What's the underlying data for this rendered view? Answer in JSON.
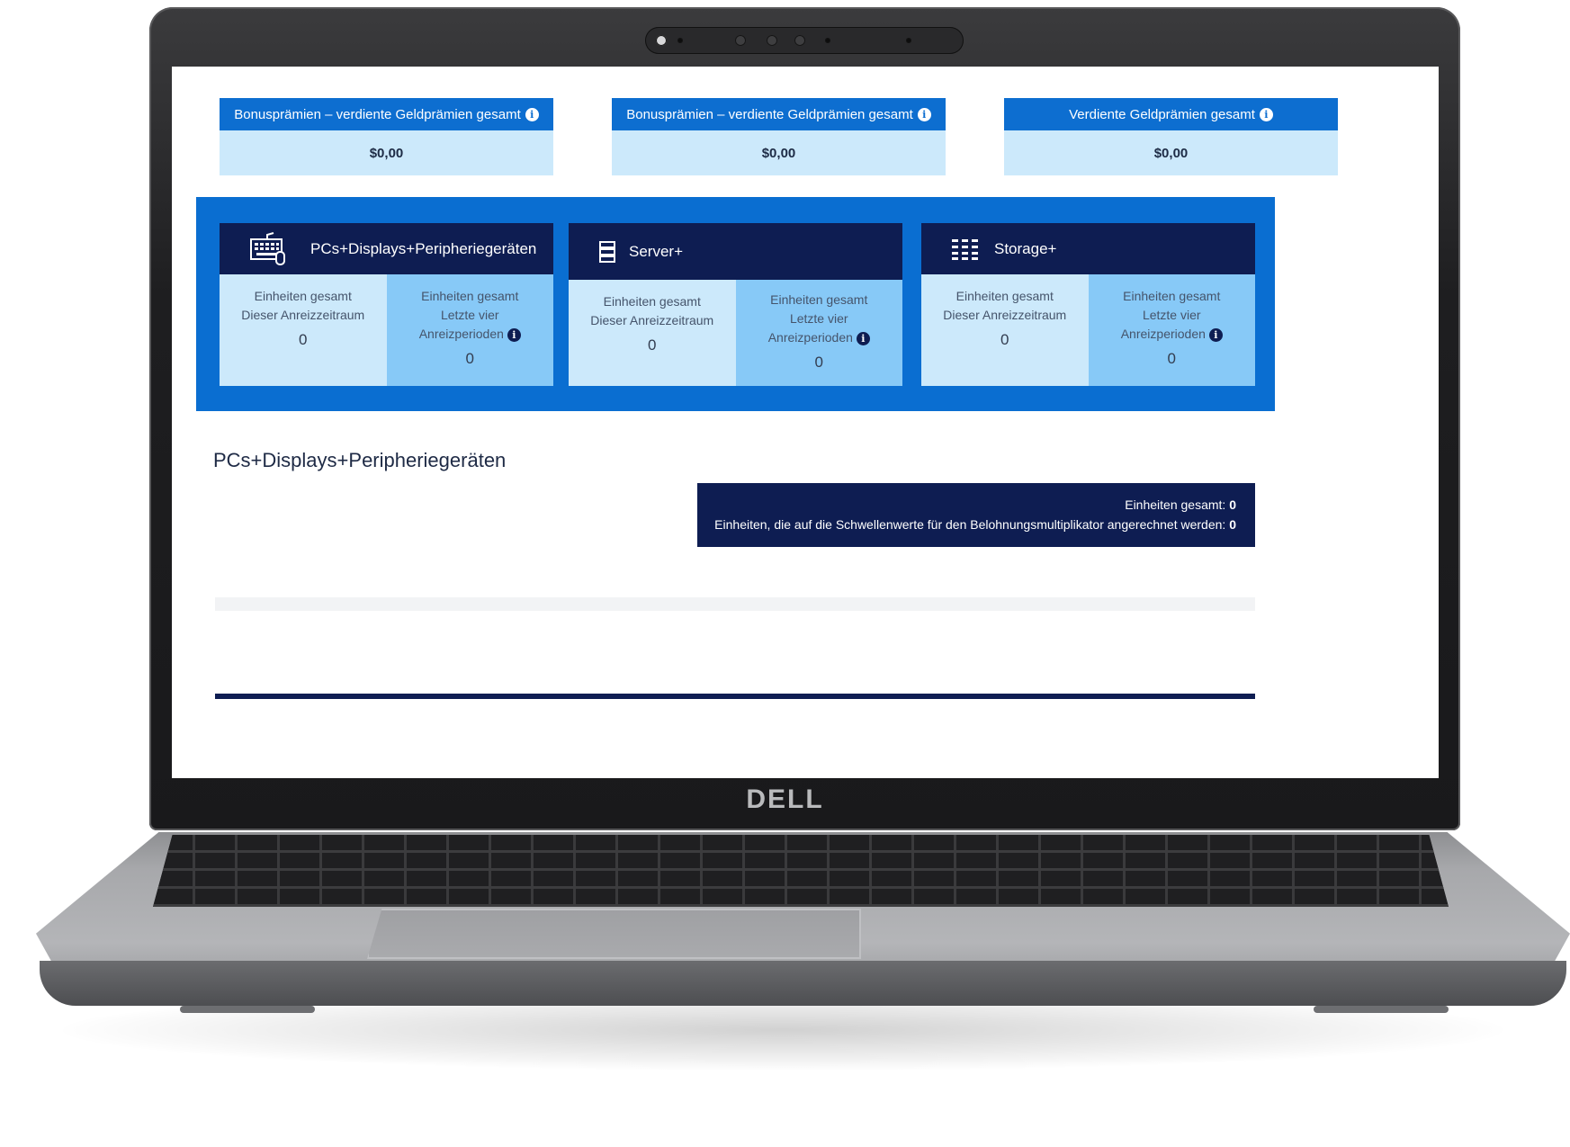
{
  "device": {
    "brand_logo": "DELL"
  },
  "reward_cards": [
    {
      "title": "Bonusprämien – verdiente Geldprämien gesamt",
      "value": "$0,00"
    },
    {
      "title": "Bonusprämien – verdiente Geldprämien gesamt",
      "value": "$0,00"
    },
    {
      "title": "Verdiente Geldprämien gesamt",
      "value": "$0,00"
    }
  ],
  "categories": [
    {
      "name": "PCs+Displays+Peripheriegeräten",
      "icon": "keyboard-icon",
      "current": {
        "line1": "Einheiten gesamt",
        "line2": "Dieser Anreizzeitraum",
        "value": "0"
      },
      "last4": {
        "line1": "Einheiten gesamt",
        "line2": "Letzte vier",
        "line3": "Anreizperioden",
        "value": "0"
      }
    },
    {
      "name": "Server+",
      "icon": "server-icon",
      "current": {
        "line1": "Einheiten gesamt",
        "line2": "Dieser Anreizzeitraum",
        "value": "0"
      },
      "last4": {
        "line1": "Einheiten gesamt",
        "line2": "Letzte vier",
        "line3": "Anreizperioden",
        "value": "0"
      }
    },
    {
      "name": "Storage+",
      "icon": "storage-icon",
      "current": {
        "line1": "Einheiten gesamt",
        "line2": "Dieser Anreizzeitraum",
        "value": "0"
      },
      "last4": {
        "line1": "Einheiten gesamt",
        "line2": "Letzte vier",
        "line3": "Anreizperioden",
        "value": "0"
      }
    }
  ],
  "section": {
    "title": "PCs+Displays+Peripheriegeräten",
    "summary": {
      "total_label": "Einheiten gesamt:",
      "total_value": "0",
      "threshold_label": "Einheiten, die auf die Schwellenwerte für den Belohnungsmultiplikator angerechnet werden:",
      "threshold_value": "0"
    }
  },
  "colors": {
    "header_blue": "#0d6ed0",
    "navy": "#0e1d52",
    "light_blue": "#cce9fb",
    "mid_blue": "#87c9f7"
  }
}
